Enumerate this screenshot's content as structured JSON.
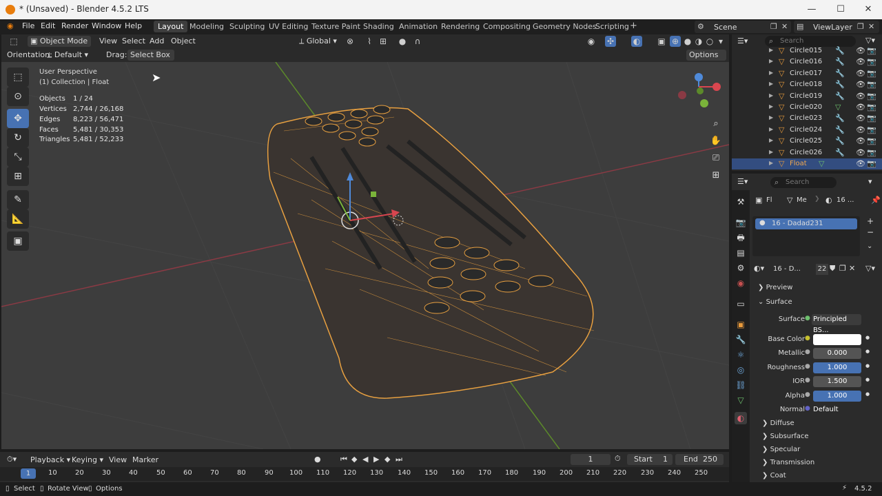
{
  "title": "* (Unsaved) - Blender 4.5.2 LTS",
  "menus": [
    "File",
    "Edit",
    "Render",
    "Window",
    "Help"
  ],
  "workspaces": [
    "Layout",
    "Modeling",
    "Sculpting",
    "UV Editing",
    "Texture Paint",
    "Shading",
    "Animation",
    "Rendering",
    "Compositing",
    "Geometry Nodes",
    "Scripting"
  ],
  "active_workspace": "Layout",
  "scene": "Scene",
  "view_layer": "ViewLayer",
  "viewport": {
    "mode": "Object Mode",
    "menus": [
      "View",
      "Select",
      "Add",
      "Object"
    ],
    "transform_space": "Global",
    "orientation_label": "Orientation:",
    "orientation": "Default",
    "drag_label": "Drag:",
    "drag": "Select Box",
    "options": "Options",
    "view_name": "User Perspective",
    "collection": "(1) Collection | Float",
    "stats": [
      {
        "label": "Objects",
        "value": "1 / 24"
      },
      {
        "label": "Vertices",
        "value": "2,744 / 26,168"
      },
      {
        "label": "Edges",
        "value": "8,223 / 56,471"
      },
      {
        "label": "Faces",
        "value": "5,481 / 30,353"
      },
      {
        "label": "Triangles",
        "value": "5,481 / 52,233"
      }
    ],
    "wire_color": "#e8a040"
  },
  "outliner": {
    "search_placeholder": "Search",
    "items": [
      {
        "name": "Circle015",
        "selected": false
      },
      {
        "name": "Circle016",
        "selected": false
      },
      {
        "name": "Circle017",
        "selected": false
      },
      {
        "name": "Circle018",
        "selected": false
      },
      {
        "name": "Circle019",
        "selected": false
      },
      {
        "name": "Circle020",
        "selected": false
      },
      {
        "name": "Circle023",
        "selected": false
      },
      {
        "name": "Circle024",
        "selected": false
      },
      {
        "name": "Circle025",
        "selected": false
      },
      {
        "name": "Circle026",
        "selected": false
      },
      {
        "name": "Float",
        "selected": true
      }
    ]
  },
  "properties": {
    "search_placeholder": "Search",
    "breadcrumb": [
      "Fl",
      "Me",
      "16 ..."
    ],
    "material_slot": "16 - Dadad231",
    "material_name": "16 - D...",
    "users": "22",
    "sections": {
      "preview": "Preview",
      "surface": "Surface"
    },
    "surface_shader_label": "Surface",
    "surface_shader": "Principled BS...",
    "fields": [
      {
        "label": "Base Color",
        "value": ""
      },
      {
        "label": "Metallic",
        "value": "0.000"
      },
      {
        "label": "Roughness",
        "value": "1.000"
      },
      {
        "label": "IOR",
        "value": "1.500"
      },
      {
        "label": "Alpha",
        "value": "1.000"
      }
    ],
    "normal_label": "Normal",
    "normal_value": "Default",
    "subsections": [
      "Diffuse",
      "Subsurface",
      "Specular",
      "Transmission",
      "Coat"
    ]
  },
  "timeline": {
    "menus": [
      "Playback",
      "Keying",
      "View",
      "Marker"
    ],
    "current_frame": "1",
    "start_label": "Start",
    "start": "1",
    "end_label": "End",
    "end": "250",
    "ticks": [
      "1",
      "10",
      "20",
      "30",
      "40",
      "50",
      "60",
      "70",
      "80",
      "90",
      "100",
      "110",
      "120",
      "130",
      "140",
      "150",
      "160",
      "170",
      "180",
      "190",
      "200",
      "210",
      "220",
      "230",
      "240",
      "250"
    ]
  },
  "statusbar": {
    "items": [
      "Select",
      "Rotate View",
      "Options"
    ],
    "version": "4.5.2"
  }
}
